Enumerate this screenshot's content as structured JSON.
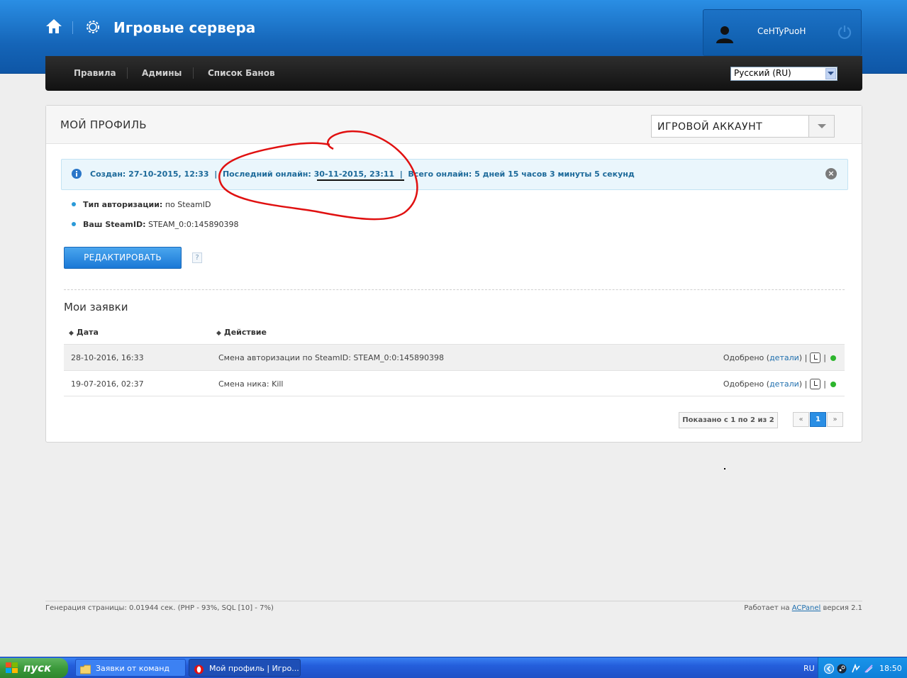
{
  "header": {
    "site_title": "Игровые сервера",
    "username": "CeHTyPuoH"
  },
  "nav": {
    "items": [
      "Правила",
      "Админы",
      "Список Банов"
    ],
    "language": "Русский (RU)"
  },
  "profile": {
    "title": "МОЙ ПРОФИЛЬ",
    "account_select": "ИГРОВОЙ АККАУНТ",
    "info": {
      "created_label": "Создан:",
      "created": "27-10-2015, 12:33",
      "last_online_label": "Последний онлайн:",
      "last_online": "30-11-2015, 23:11",
      "total_online_label": "Всего онлайн:",
      "total_online": "5 дней 15 часов 3 минуты 5 секунд"
    },
    "props": [
      {
        "label": "Тип авторизации:",
        "value": "по SteamID"
      },
      {
        "label": "Ваш SteamID:",
        "value": "STEAM_0:0:145890398"
      }
    ],
    "edit_button": "РЕДАКТИРОВАТЬ",
    "help_glyph": "?"
  },
  "requests": {
    "title": "Мои заявки",
    "columns": [
      "Дата",
      "Действие"
    ],
    "rows": [
      {
        "date": "28-10-2016, 16:33",
        "action": "Смена авторизации по SteamID: STEAM_0:0:145890398",
        "status": "Одобрено",
        "details": "детали"
      },
      {
        "date": "19-07-2016, 02:37",
        "action": "Смена ника: Kill",
        "status": "Одобрено",
        "details": "детали"
      }
    ],
    "pager_info": "Показано с 1 по 2 из 2",
    "pager": {
      "prev": "«",
      "current": "1",
      "next": "»"
    }
  },
  "footer": {
    "generation": "Генерация страницы: 0.01944 сек. (PHP - 93%, SQL [10] - 7%)",
    "powered_prefix": "Работает на",
    "powered_link": "ACPanel",
    "powered_suffix": "версия 2.1"
  },
  "taskbar": {
    "start": "пуск",
    "tasks": [
      "Заявки от команд",
      "Мой профиль | Игро..."
    ],
    "lang": "RU",
    "clock": "18:50"
  },
  "colors": {
    "header_blue": "#1565b8",
    "accent_blue": "#2a8ee4",
    "info_text": "#1d6a9a",
    "approved_dot": "#2db52d",
    "annotation_red": "#e01010"
  }
}
